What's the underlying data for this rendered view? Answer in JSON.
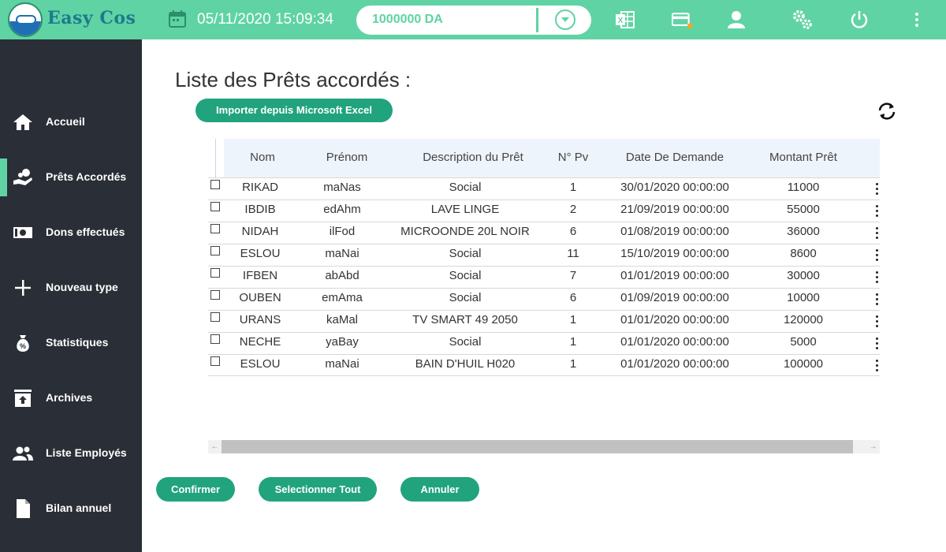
{
  "app": {
    "name": "Easy Cos"
  },
  "header": {
    "datetime": "05/11/2020 15:09:34",
    "budget": "1000000 DA",
    "icons": [
      "calendar-icon",
      "excel-icon",
      "card-icon",
      "user-icon",
      "settings-icon",
      "power-icon",
      "more-vertical-icon"
    ]
  },
  "sidebar": {
    "items": [
      {
        "label": "Accueil",
        "icon": "home-icon"
      },
      {
        "label": "Prêts Accordés",
        "icon": "loan-hand-icon",
        "active": true
      },
      {
        "label": "Dons effectués",
        "icon": "money-icon"
      },
      {
        "label": "Nouveau type",
        "icon": "plus-icon"
      },
      {
        "label": "Statistiques",
        "icon": "money-bag-icon"
      },
      {
        "label": "Archives",
        "icon": "archive-icon"
      },
      {
        "label": "Liste Employés",
        "icon": "people-icon"
      },
      {
        "label": "Bilan annuel",
        "icon": "document-icon"
      }
    ]
  },
  "main": {
    "title": "Liste des Prêts accordés :",
    "import_label": "Importer depuis Microsoft Excel",
    "columns": [
      "Nom",
      "Prénom",
      "Description du Prêt",
      "N° Pv",
      "Date De Demande",
      "Montant Prêt"
    ],
    "rows": [
      [
        "RIKAD",
        "maNas",
        "Social",
        "1",
        "30/01/2020 00:00:00",
        "11000"
      ],
      [
        "IBDIB",
        "edAhm",
        "LAVE LINGE",
        "2",
        "21/09/2019 00:00:00",
        "55000"
      ],
      [
        "NIDAH",
        "ilFod",
        "MICROONDE 20L NOIR",
        "6",
        "01/08/2019 00:00:00",
        "36000"
      ],
      [
        "ESLOU",
        "maNai",
        "Social",
        "11",
        "15/10/2019 00:00:00",
        "8600"
      ],
      [
        "IFBEN",
        "abAbd",
        "Social",
        "7",
        "01/01/2019 00:00:00",
        "30000"
      ],
      [
        "OUBEN",
        "emAma",
        "Social",
        "6",
        "01/09/2019 00:00:00",
        "10000"
      ],
      [
        "URANS",
        "kaMal",
        "TV SMART 49 2050",
        "1",
        "01/01/2020 00:00:00",
        "120000"
      ],
      [
        "NECHE",
        "yaBay",
        "Social",
        "1",
        "01/01/2020 00:00:00",
        "5000"
      ],
      [
        "ESLOU",
        "maNai",
        "BAIN D'HUIL H020",
        "1",
        "01/01/2020 00:00:00",
        "100000"
      ]
    ],
    "buttons": {
      "confirm": "Confirmer",
      "select_all": "Selectionner Tout",
      "cancel": "Annuler"
    }
  },
  "colors": {
    "accent": "#5fd3a4",
    "button": "#21a37e",
    "sidebar": "#2a2e36",
    "brand_text": "#1f7a8c"
  }
}
